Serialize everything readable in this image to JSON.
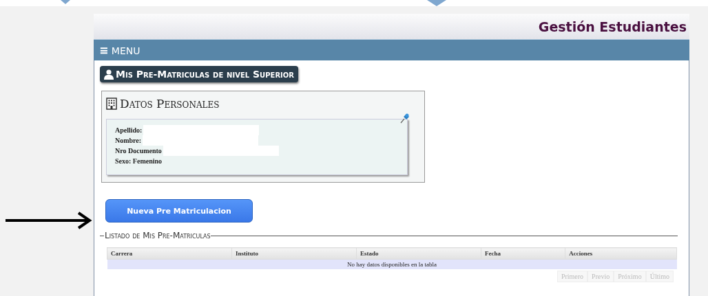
{
  "header": {
    "title": "Gestión Estudiantes"
  },
  "menu": {
    "icon": "≡",
    "label": "MENU"
  },
  "page_title": "Mis Pre-Matriculas de nivel Superior",
  "personal_card": {
    "title": "Datos Personales",
    "fields": [
      {
        "label": "Apellido:",
        "redacted": true
      },
      {
        "label": "Nombre:",
        "redacted": true
      },
      {
        "label": "Nro Documento",
        "redacted": true
      },
      {
        "label": "Sexo: Femenino",
        "redacted": false
      }
    ]
  },
  "new_button": "Nueva Pre Matriculacion",
  "listing": {
    "legend": "Listado de Mis Pre-Matriculas",
    "columns": [
      "Carrera",
      "Instituto",
      "Estado",
      "Fecha",
      "Acciones"
    ],
    "empty_message": "No hay datos disponibles en la tabla",
    "pagination": [
      {
        "label": "Primero",
        "disabled": true
      },
      {
        "label": "Previo",
        "disabled": true
      },
      {
        "label": "Próximo",
        "disabled": true
      },
      {
        "label": "Último",
        "disabled": true
      }
    ]
  }
}
